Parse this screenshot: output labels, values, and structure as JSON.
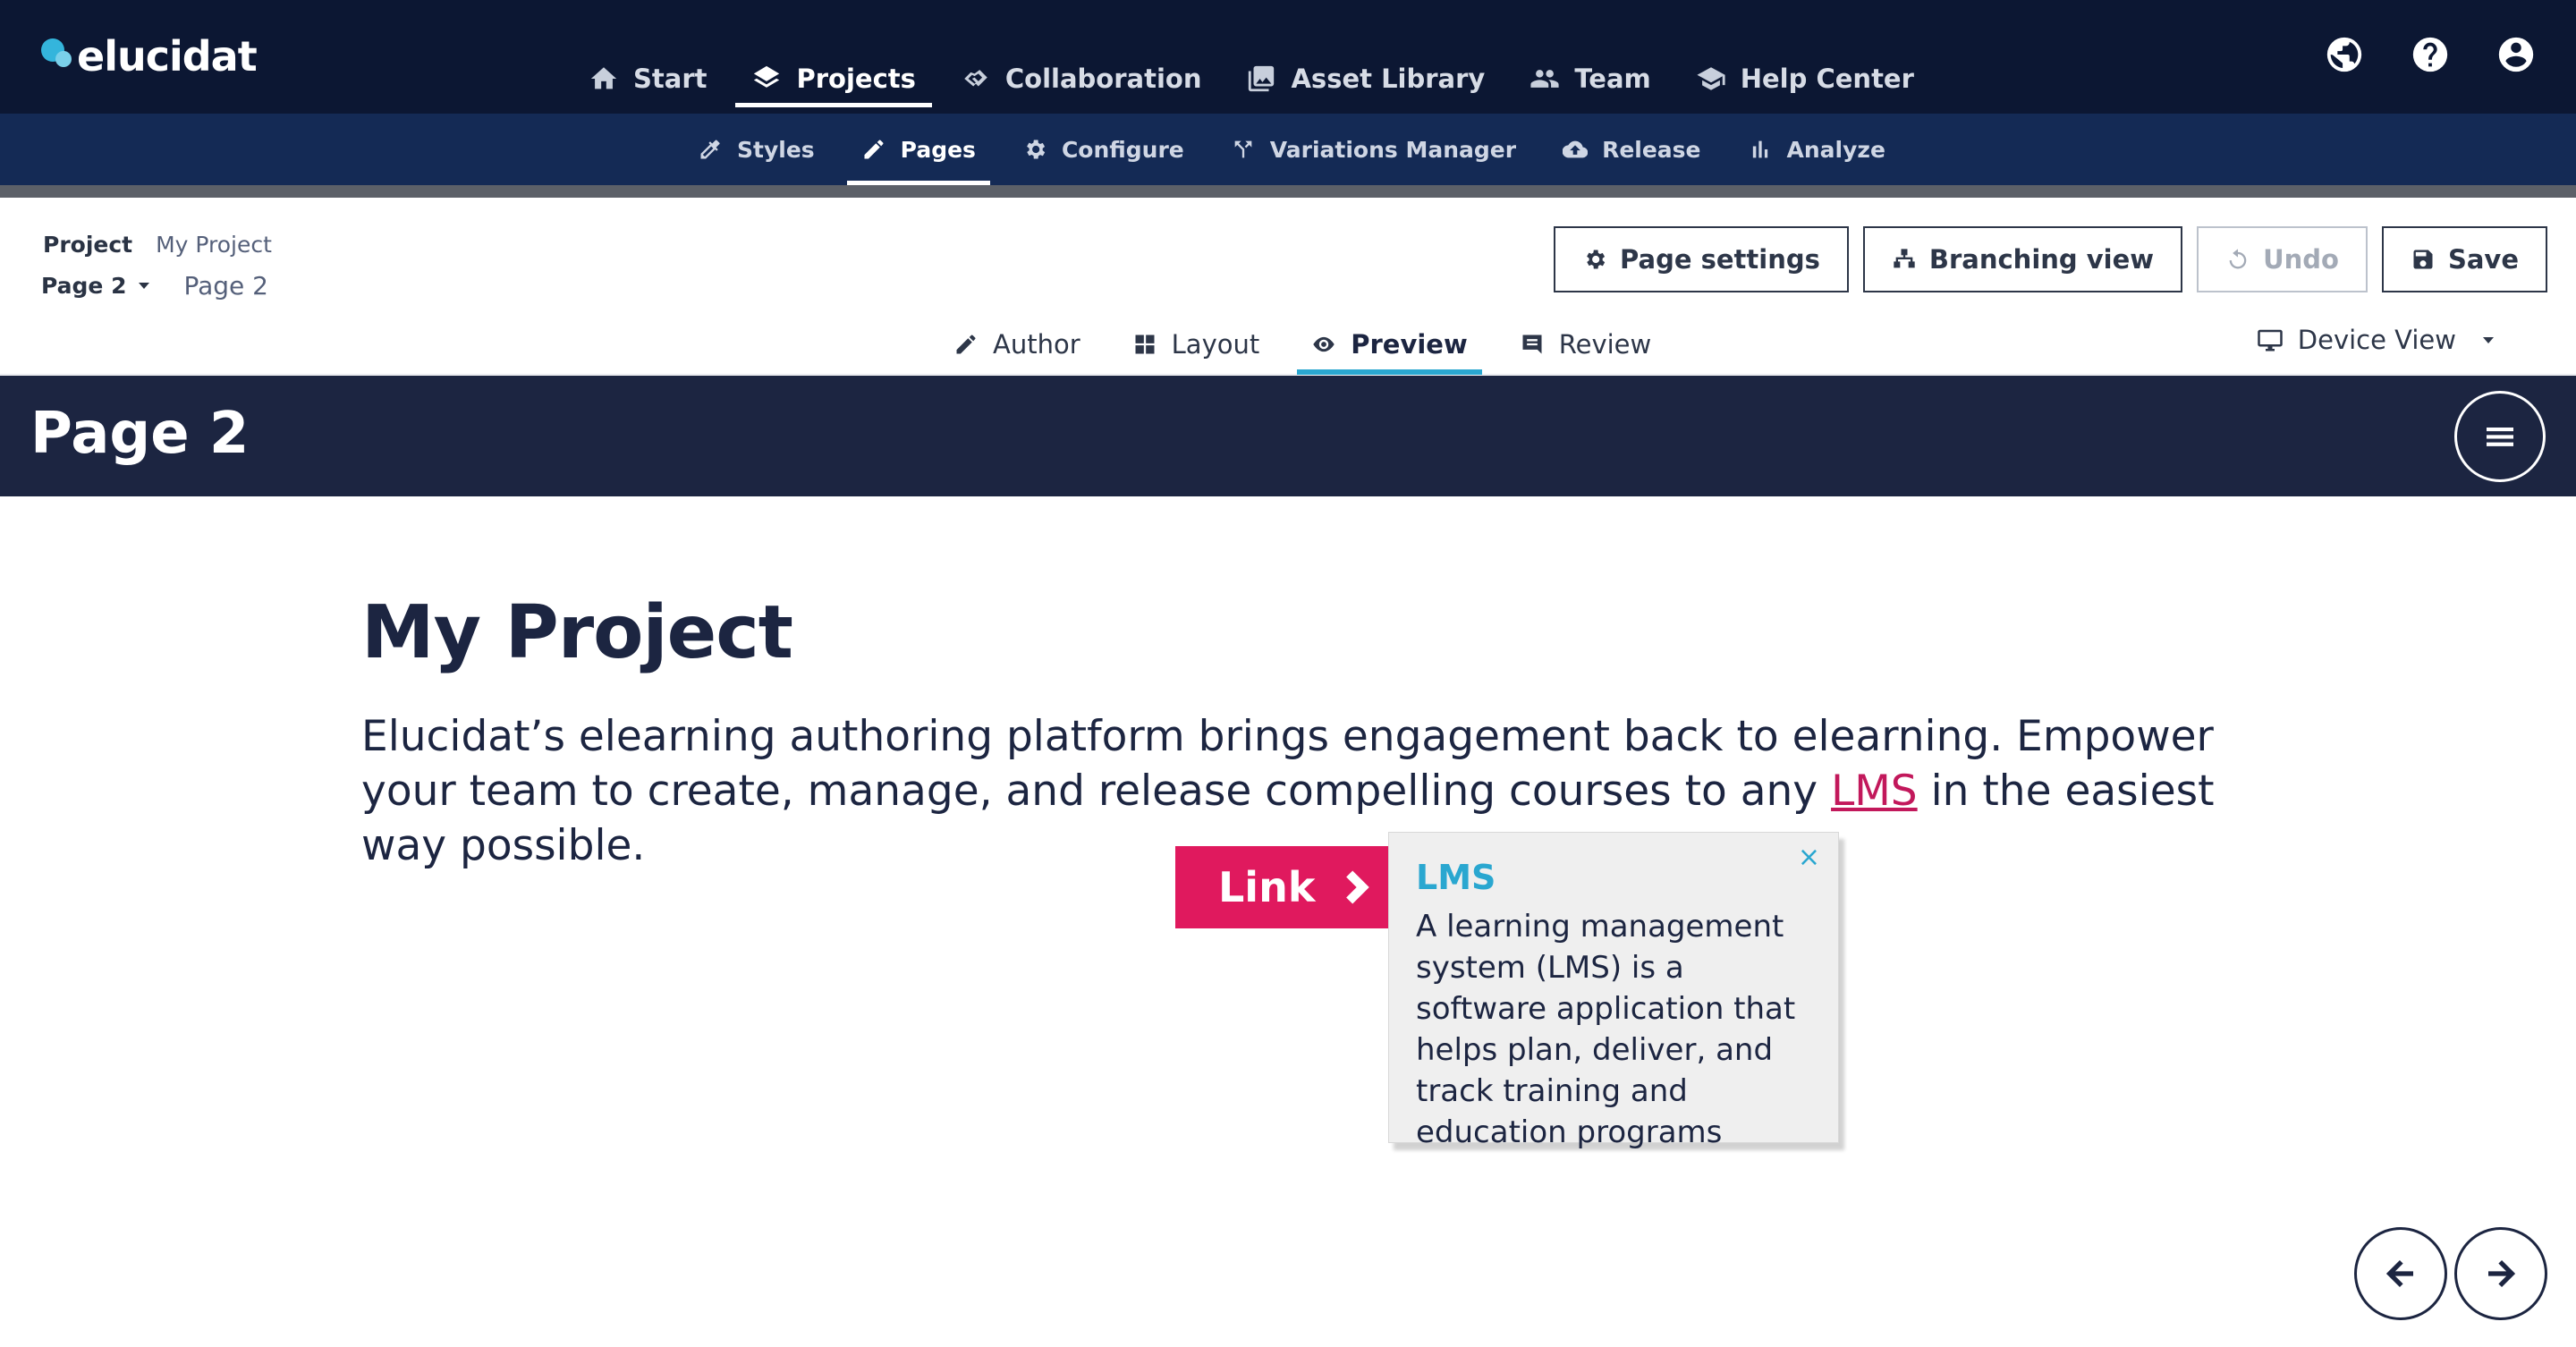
{
  "brand": {
    "name": "elucidat"
  },
  "main_nav": [
    {
      "label": "Start",
      "icon": "home-icon"
    },
    {
      "label": "Projects",
      "icon": "layers-icon",
      "active": true
    },
    {
      "label": "Collaboration",
      "icon": "handshake-icon"
    },
    {
      "label": "Asset Library",
      "icon": "images-icon"
    },
    {
      "label": "Team",
      "icon": "team-icon"
    },
    {
      "label": "Help Center",
      "icon": "graduation-cap-icon"
    }
  ],
  "top_icons": [
    "globe-icon",
    "help-icon",
    "account-icon"
  ],
  "sub_nav": [
    {
      "label": "Styles",
      "icon": "eyedropper-icon"
    },
    {
      "label": "Pages",
      "icon": "pencil-icon",
      "active": true
    },
    {
      "label": "Configure",
      "icon": "gear-icon"
    },
    {
      "label": "Variations Manager",
      "icon": "fork-icon"
    },
    {
      "label": "Release",
      "icon": "cloud-upload-icon"
    },
    {
      "label": "Analyze",
      "icon": "bar-chart-icon"
    }
  ],
  "breadcrumb": {
    "project_label": "Project",
    "project_name": "My Project",
    "page_select": "Page 2",
    "page_name": "Page 2"
  },
  "actions": {
    "page_settings": "Page settings",
    "branching_view": "Branching view",
    "undo": "Undo",
    "save": "Save"
  },
  "mode_tabs": [
    {
      "label": "Author",
      "icon": "pencil-icon"
    },
    {
      "label": "Layout",
      "icon": "grid-icon"
    },
    {
      "label": "Preview",
      "icon": "eye-icon",
      "active": true
    },
    {
      "label": "Review",
      "icon": "comment-icon"
    }
  ],
  "device_view": {
    "label": "Device View",
    "icon": "monitor-icon"
  },
  "preview": {
    "page_title": "Page 2",
    "heading": "My Project",
    "para_before": "Elucidat’s elearning authoring platform brings engagement back to elearning. Empower your team to create, manage, and release compelling courses to any ",
    "para_link": "LMS",
    "para_after": " in the easiest way possible.",
    "link_button": "Link",
    "tooltip": {
      "close": "×",
      "title": "LMS",
      "body": "A learning management system (LMS) is a software application that helps plan, deliver, and track training and education programs"
    }
  },
  "colors": {
    "topbar": "#0c1733",
    "subbar": "#142a55",
    "accent": "#2aa7d0",
    "link_button": "#e0195e",
    "preview_header": "#1c2541"
  }
}
